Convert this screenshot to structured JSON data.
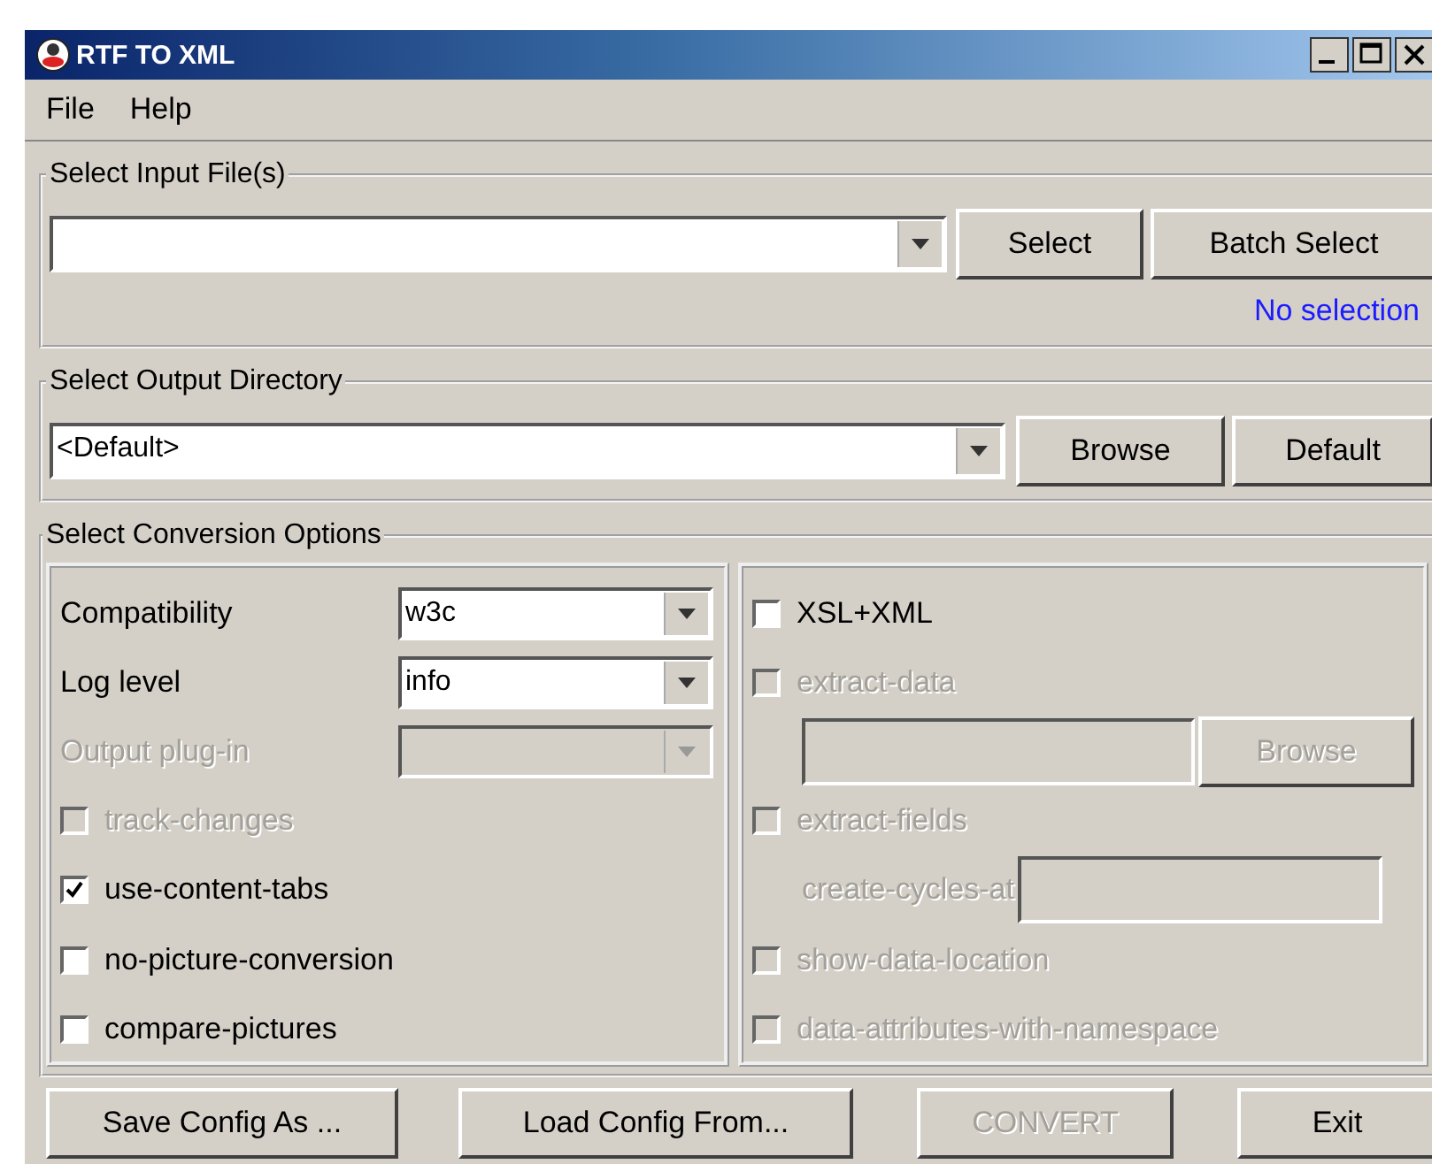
{
  "window": {
    "title": "RTF TO XML"
  },
  "menu": [
    "File",
    "Help"
  ],
  "input_group": {
    "title": "Select Input File(s)",
    "buttons": [
      "Select",
      "Batch Select"
    ],
    "status": "No selection"
  },
  "output_group": {
    "title": "Select Output Directory",
    "value": "<Default>",
    "buttons": [
      "Browse",
      "Default"
    ]
  },
  "options_group": {
    "title": "Select Conversion Options",
    "left": [
      {
        "kind": "select",
        "label": "Compatibility",
        "value": "w3c",
        "disabled": false
      },
      {
        "kind": "select",
        "label": "Log level",
        "value": "info",
        "disabled": false
      },
      {
        "kind": "select",
        "label": "Output plug-in",
        "disabled": true
      },
      {
        "kind": "checkbox",
        "label": "track-changes",
        "checked": false,
        "disabled": true
      },
      {
        "kind": "checkbox",
        "label": "use-content-tabs",
        "checked": true,
        "disabled": false
      },
      {
        "kind": "checkbox",
        "label": "no-picture-conversion",
        "checked": false,
        "disabled": false
      },
      {
        "kind": "checkbox",
        "label": "compare-pictures",
        "checked": false,
        "disabled": false
      }
    ],
    "right": [
      {
        "kind": "checkbox",
        "label": "XSL+XML",
        "checked": false,
        "disabled": false
      },
      {
        "kind": "checkbox",
        "label": "extract-data",
        "checked": false,
        "disabled": true
      },
      {
        "kind": "field-button",
        "button": "Browse",
        "disabled": true
      },
      {
        "kind": "checkbox",
        "label": "extract-fields",
        "checked": false,
        "disabled": true
      },
      {
        "kind": "labeled-field",
        "label": "create-cycles-at",
        "disabled": true
      },
      {
        "kind": "checkbox",
        "label": "show-data-location",
        "checked": false,
        "disabled": true
      },
      {
        "kind": "checkbox",
        "label": "data-attributes-with-namespace",
        "checked": false,
        "disabled": true
      }
    ]
  },
  "buttons": [
    {
      "label": "Save Config As ...",
      "disabled": false
    },
    {
      "label": "Load Config From...",
      "disabled": false
    },
    {
      "label": "CONVERT",
      "disabled": true
    },
    {
      "label": "Exit",
      "disabled": false
    }
  ]
}
